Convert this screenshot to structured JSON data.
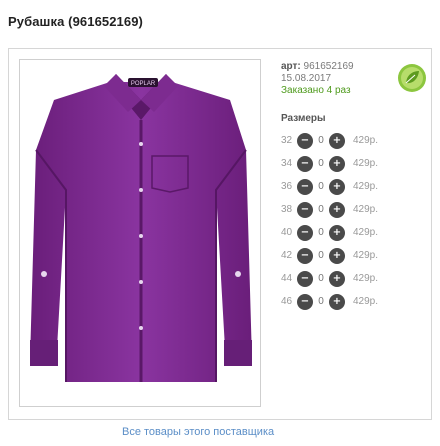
{
  "product": {
    "title": "Рубашка (961652169)",
    "article_label": "арт:",
    "article_number": "961652169",
    "date": "15.08.2017",
    "ordered_text": "Заказано 4 раз",
    "photo_brand_text": "POPLAR"
  },
  "sizes": {
    "header": "Размеры",
    "rows": [
      {
        "size": "32",
        "qty": "0",
        "price": "429р."
      },
      {
        "size": "34",
        "qty": "0",
        "price": "429р."
      },
      {
        "size": "36",
        "qty": "0",
        "price": "429р."
      },
      {
        "size": "38",
        "qty": "0",
        "price": "429р."
      },
      {
        "size": "40",
        "qty": "0",
        "price": "429р."
      },
      {
        "size": "42",
        "qty": "0",
        "price": "429р."
      },
      {
        "size": "44",
        "qty": "0",
        "price": "429р."
      },
      {
        "size": "46",
        "qty": "0",
        "price": "429р."
      }
    ],
    "minus_symbol": "−",
    "plus_symbol": "+"
  },
  "footer": {
    "supplier_link": "Все товары этого поставщика"
  },
  "colors": {
    "shirt": "#7a2a8a",
    "shirt_dark": "#5a1868",
    "link": "#5b8ec7",
    "eco_badge": "#8cc63f",
    "ordered_green": "#4e9a1c"
  },
  "icons": {
    "eco_badge": "leaf-eco-icon",
    "minus": "minus-circle-icon",
    "plus": "plus-circle-icon"
  }
}
